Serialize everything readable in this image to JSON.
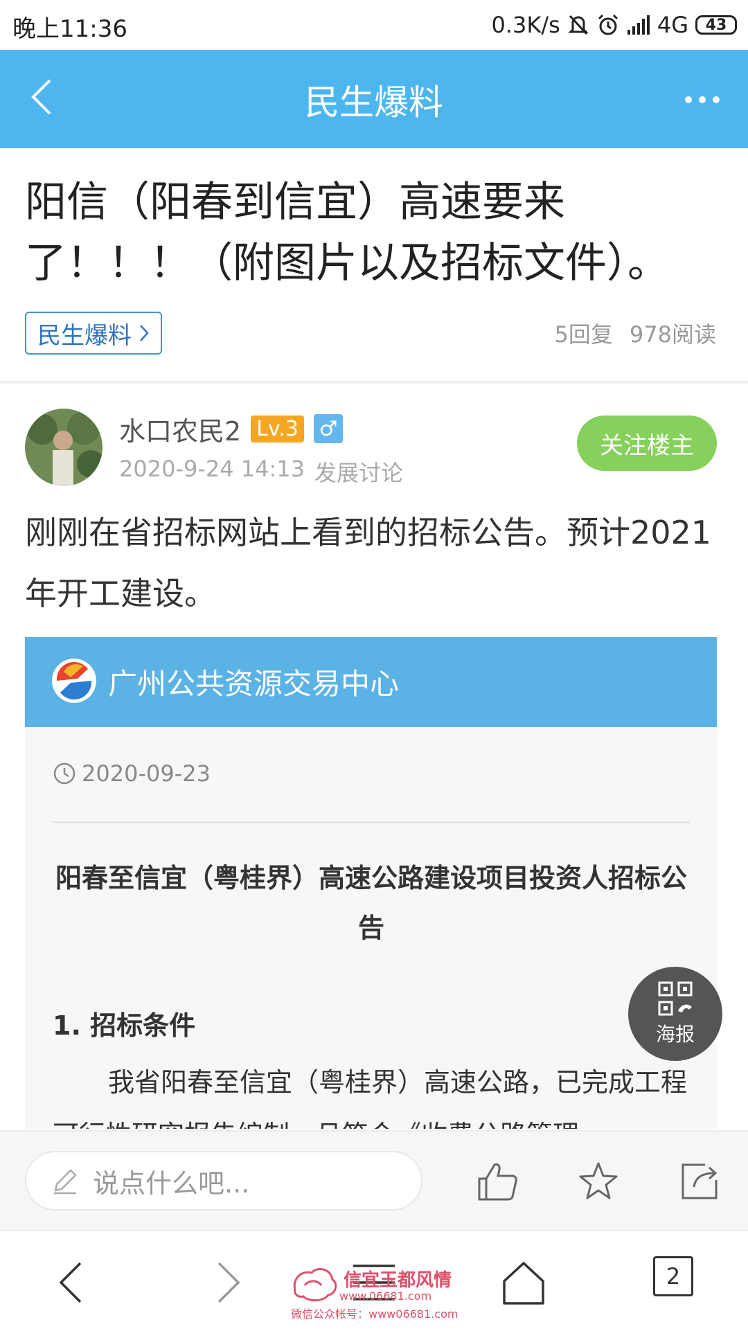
{
  "status_bar": {
    "time": "晚上11:36",
    "net_speed": "0.3K/s",
    "network": "4G",
    "battery": "43"
  },
  "nav": {
    "title": "民生爆料"
  },
  "post": {
    "title": "阳信（阳春到信宜）高速要来了！！！（附图片以及招标文件）。",
    "board_tag": "民生爆料",
    "replies": "5回复",
    "reads": "978阅读",
    "author": {
      "name": "水口农民2",
      "level": "Lv.3",
      "gender": "♂",
      "datetime": "2020-9-24 14:13",
      "category": "发展讨论",
      "follow_label": "关注楼主"
    },
    "body": "刚刚在省招标网站上看到的招标公告。预计2021年开工建设。",
    "attachment": {
      "org": "广州公共资源交易中心",
      "date": "2020-09-23",
      "title": "阳春至信宜（粤桂界）高速公路建设项目投资人招标公告",
      "section": "1. 招标条件",
      "paragraph": "我省阳春至信宜（粤桂界）高速公路，已完成工程可行性研究报告编制，且符合《收费公路管理"
    }
  },
  "poster_button": {
    "label": "海报"
  },
  "comment_bar": {
    "placeholder": "说点什么吧..."
  },
  "bottom_nav": {
    "tabs_count": "2"
  },
  "watermark": {
    "title": "信宜玉都风情",
    "url": "www.06681.com",
    "sub": "微信公众帐号：www06681.com"
  }
}
